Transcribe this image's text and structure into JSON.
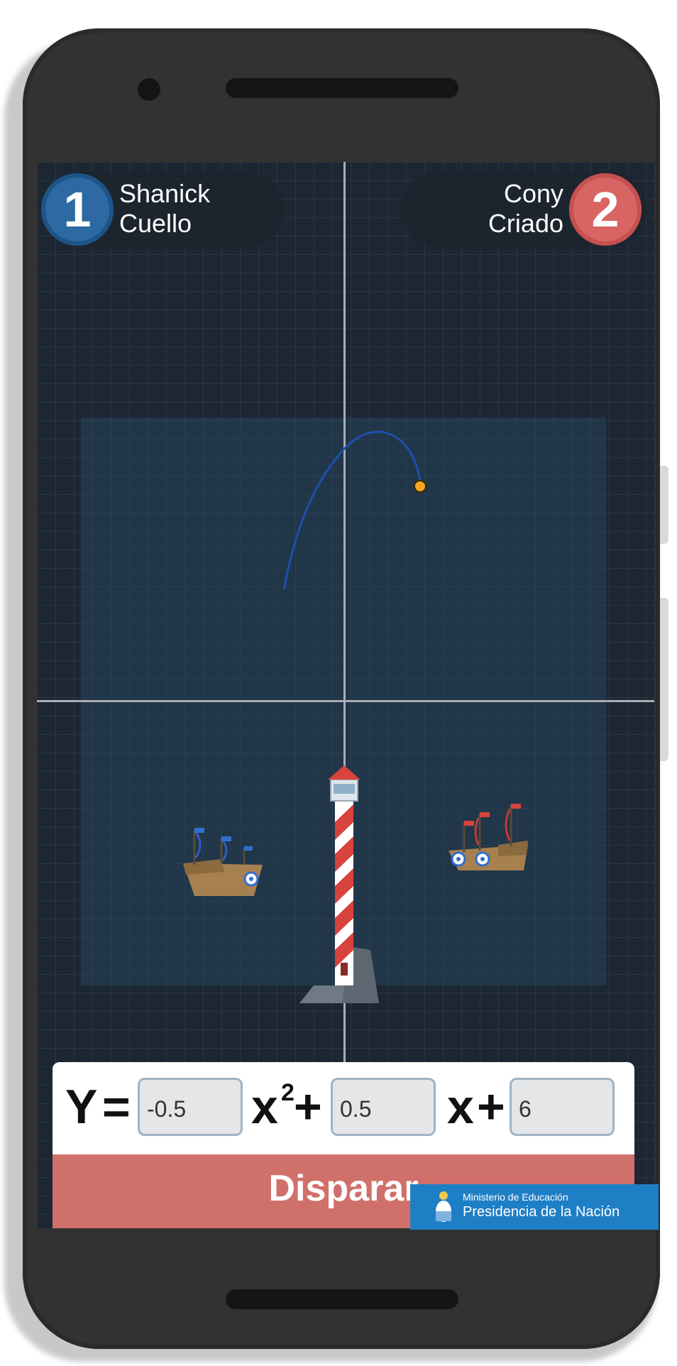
{
  "players": {
    "p1": {
      "number": "1",
      "first_name": "Shanick",
      "last_name": "Cuello"
    },
    "p2": {
      "number": "2",
      "first_name": "Cony",
      "last_name": "Criado"
    }
  },
  "equation": {
    "y_label": "Y",
    "equals": "=",
    "x2_label": "x",
    "exponent": "2",
    "plus": "+",
    "x_label": "x",
    "a_value": "-0.5",
    "b_value": "0.5",
    "c_value": "6"
  },
  "fire_button": {
    "label": "Disparar"
  },
  "ministry": {
    "line1": "Ministerio de Educación",
    "line2": "Presidencia de la Nación"
  },
  "colors": {
    "player1": "#2d6aa3",
    "player2": "#d86464",
    "fire_button": "#d0706b",
    "trajectory": "#1e4fb0",
    "ministry_banner": "#1f7fc5"
  }
}
